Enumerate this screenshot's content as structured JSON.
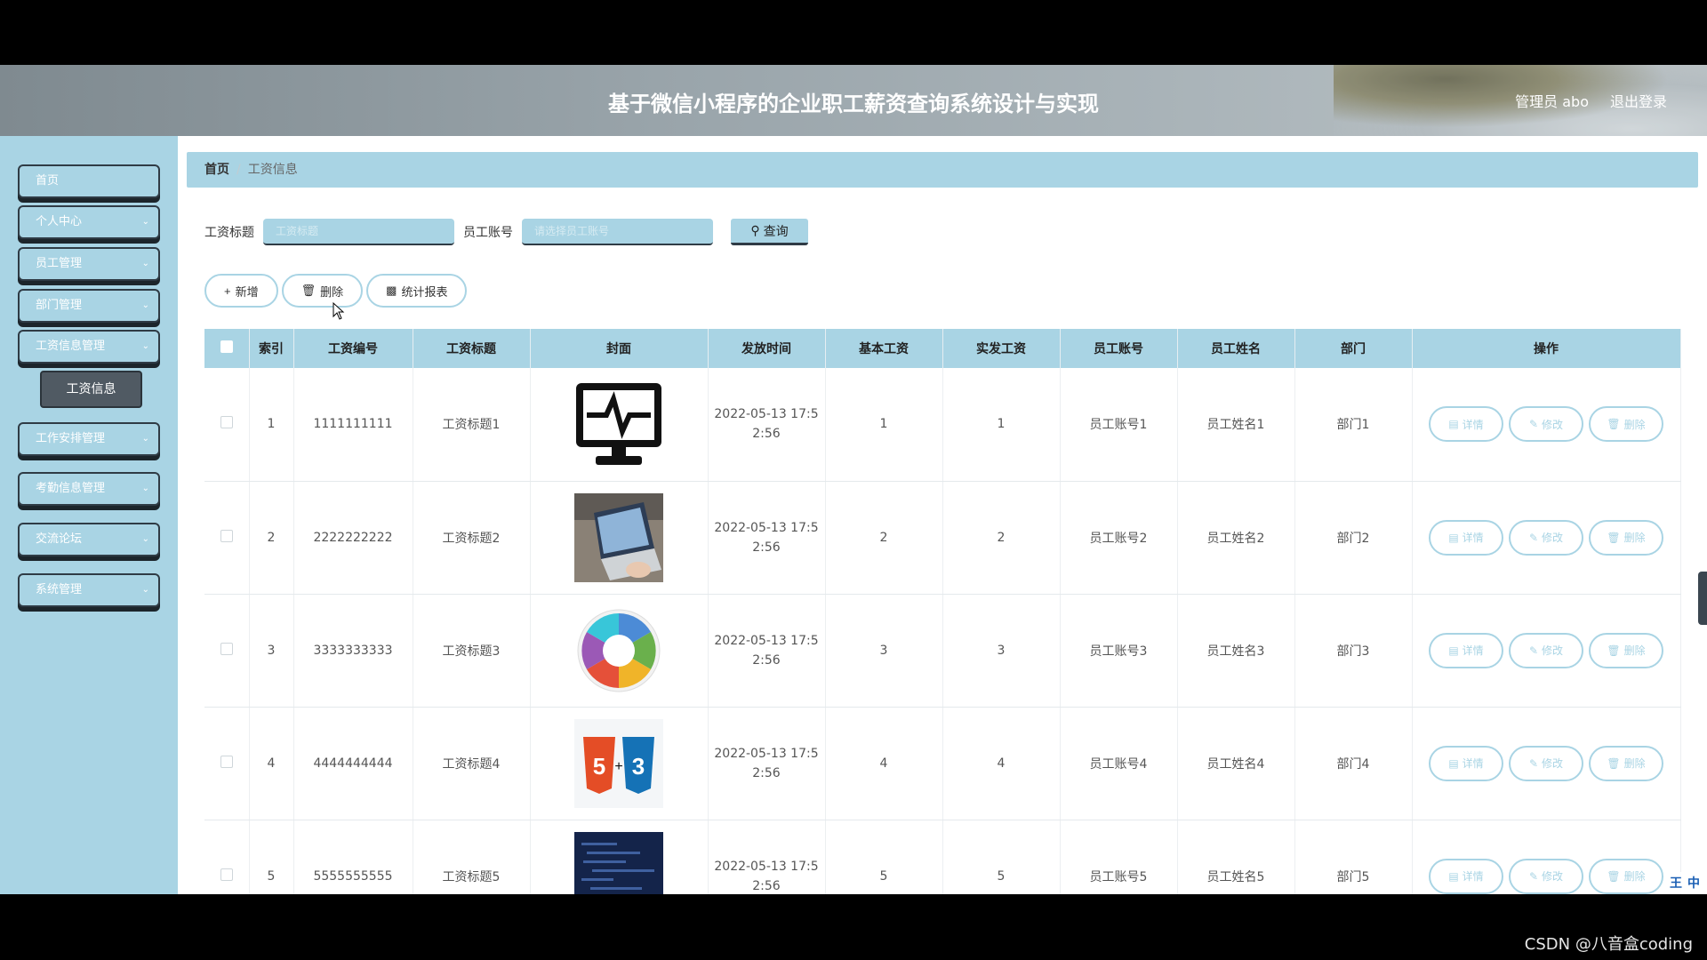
{
  "header": {
    "title": "基于微信小程序的企业职工薪资查询系统设计与实现",
    "user": "管理员 abo",
    "logout": "退出登录"
  },
  "sidebar": {
    "items": [
      {
        "label": "首页",
        "chevron": false
      },
      {
        "label": "个人中心",
        "chevron": true
      },
      {
        "label": "员工管理",
        "chevron": true
      },
      {
        "label": "部门管理",
        "chevron": true
      },
      {
        "label": "工资信息管理",
        "chevron": true
      },
      {
        "label": "工作安排管理",
        "chevron": true
      },
      {
        "label": "考勤信息管理",
        "chevron": true
      },
      {
        "label": "交流论坛",
        "chevron": true
      },
      {
        "label": "系统管理",
        "chevron": true
      }
    ],
    "sub_item": "工资信息"
  },
  "breadcrumb": {
    "home": "首页",
    "current": "工资信息"
  },
  "search": {
    "title_label": "工资标题",
    "title_placeholder": "工资标题",
    "account_label": "员工账号",
    "account_placeholder": "请选择员工账号",
    "query_label": "查询"
  },
  "actions": {
    "add": "新增",
    "delete": "删除",
    "report": "统计报表"
  },
  "table": {
    "headers": [
      "索引",
      "工资编号",
      "工资标题",
      "封面",
      "发放时间",
      "基本工资",
      "实发工资",
      "员工账号",
      "员工姓名",
      "部门",
      "操作"
    ],
    "rows": [
      {
        "index": "1",
        "no": "1111111111",
        "title": "工资标题1",
        "cover": "monitor-icon",
        "time_line1": "2022-05-13 17:5",
        "time_line2": "2:56",
        "base": "1",
        "actual": "1",
        "account": "员工账号1",
        "name": "员工姓名1",
        "dept": "部门1"
      },
      {
        "index": "2",
        "no": "2222222222",
        "title": "工资标题2",
        "cover": "laptop-photo",
        "time_line1": "2022-05-13 17:5",
        "time_line2": "2:56",
        "base": "2",
        "actual": "2",
        "account": "员工账号2",
        "name": "员工姓名2",
        "dept": "部门2"
      },
      {
        "index": "3",
        "no": "3333333333",
        "title": "工资标题3",
        "cover": "java-wheel",
        "time_line1": "2022-05-13 17:5",
        "time_line2": "2:56",
        "base": "3",
        "actual": "3",
        "account": "员工账号3",
        "name": "员工姓名3",
        "dept": "部门3"
      },
      {
        "index": "4",
        "no": "4444444444",
        "title": "工资标题4",
        "cover": "html5-css3",
        "time_line1": "2022-05-13 17:5",
        "time_line2": "2:56",
        "base": "4",
        "actual": "4",
        "account": "员工账号4",
        "name": "员工姓名4",
        "dept": "部门4"
      },
      {
        "index": "5",
        "no": "5555555555",
        "title": "工资标题5",
        "cover": "code-dark",
        "time_line1": "2022-05-13 17:5",
        "time_line2": "2:56",
        "base": "5",
        "actual": "5",
        "account": "员工账号5",
        "name": "员工姓名5",
        "dept": "部门5"
      }
    ],
    "ops": {
      "detail": "详情",
      "edit": "修改",
      "delete": "删除"
    }
  },
  "ime": [
    "王",
    "中"
  ],
  "watermark": "CSDN @八音盒coding",
  "colors": {
    "accent": "#a9d4e4",
    "dark": "#2f3b45",
    "header": "#9aa5ab"
  }
}
